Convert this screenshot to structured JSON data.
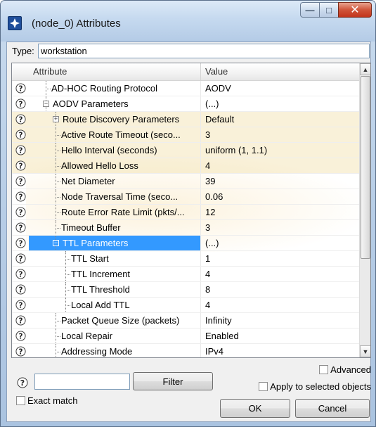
{
  "window": {
    "title": "(node_0) Attributes",
    "icon": "opnet-app-icon",
    "buttons": {
      "minimize": "minimize-icon",
      "maximize": "maximize-icon",
      "close": "close-icon"
    }
  },
  "type_field": {
    "label": "Type:",
    "value": "workstation"
  },
  "grid": {
    "headers": {
      "attribute": "Attribute",
      "value": "Value"
    },
    "rows": [
      {
        "attr": "AD-HOC Routing Protocol",
        "value": "AODV",
        "level": 0,
        "expander": "",
        "highlight": false,
        "selected": false
      },
      {
        "attr": "AODV Parameters",
        "value": "(...)",
        "level": 0,
        "expander": "-",
        "highlight": false,
        "selected": false
      },
      {
        "attr": "Route Discovery Parameters",
        "value": "Default",
        "level": 1,
        "expander": "+",
        "highlight": true,
        "selected": false
      },
      {
        "attr": "Active Route Timeout (seco...",
        "value": "3",
        "level": 1,
        "expander": "",
        "highlight": true,
        "selected": false
      },
      {
        "attr": "Hello Interval (seconds)",
        "value": "uniform (1, 1.1)",
        "level": 1,
        "expander": "",
        "highlight": true,
        "selected": false
      },
      {
        "attr": "Allowed Hello Loss",
        "value": "4",
        "level": 1,
        "expander": "",
        "highlight": true,
        "selected": false
      },
      {
        "attr": "Net Diameter",
        "value": "39",
        "level": 1,
        "expander": "",
        "highlight": false,
        "selected": false
      },
      {
        "attr": "Node Traversal Time (seco...",
        "value": "0.06",
        "level": 1,
        "expander": "",
        "highlight": false,
        "selected": false
      },
      {
        "attr": "Route Error Rate Limit (pkts/...",
        "value": "12",
        "level": 1,
        "expander": "",
        "highlight": false,
        "selected": false
      },
      {
        "attr": "Timeout Buffer",
        "value": "3",
        "level": 1,
        "expander": "",
        "highlight": false,
        "selected": false
      },
      {
        "attr": "TTL Parameters",
        "value": "(...)",
        "level": 1,
        "expander": "-",
        "highlight": false,
        "selected": true
      },
      {
        "attr": "TTL Start",
        "value": "1",
        "level": 2,
        "expander": "",
        "highlight": false,
        "selected": false
      },
      {
        "attr": "TTL Increment",
        "value": "4",
        "level": 2,
        "expander": "",
        "highlight": false,
        "selected": false
      },
      {
        "attr": "TTL Threshold",
        "value": "8",
        "level": 2,
        "expander": "",
        "highlight": false,
        "selected": false
      },
      {
        "attr": "Local Add TTL",
        "value": "4",
        "level": 2,
        "expander": "",
        "highlight": false,
        "selected": false
      },
      {
        "attr": "Packet Queue Size (packets)",
        "value": "Infinity",
        "level": 1,
        "expander": "",
        "highlight": false,
        "selected": false
      },
      {
        "attr": "Local Repair",
        "value": "Enabled",
        "level": 1,
        "expander": "",
        "highlight": false,
        "selected": false
      },
      {
        "attr": "Addressing Mode",
        "value": "IPv4",
        "level": 1,
        "expander": "",
        "highlight": false,
        "selected": false
      }
    ]
  },
  "controls": {
    "advanced_label": "Advanced",
    "filter_button": "Filter",
    "filter_value": "",
    "apply_label": "Apply to selected objects",
    "exact_match_label": "Exact match",
    "ok_label": "OK",
    "cancel_label": "Cancel"
  },
  "colors": {
    "selection": "#3399ff",
    "highlight": "#ebcd78"
  }
}
